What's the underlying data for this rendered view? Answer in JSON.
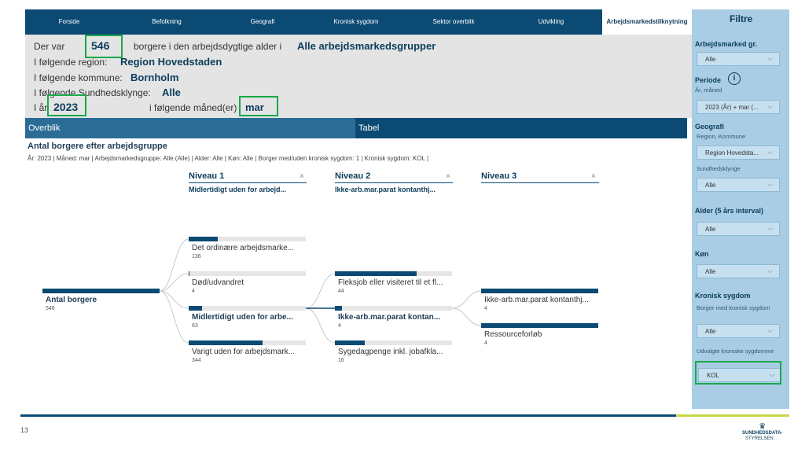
{
  "nav": {
    "tabs": [
      "Forside",
      "Befolkning",
      "Geografi",
      "Kronisk sygdom",
      "Sektor overblik",
      "Udvikling",
      "Arbejdsmarkedstilknytning"
    ]
  },
  "info": {
    "line1_prefix": "Der var",
    "count": "546",
    "line1_mid": "borgere i den arbejdsdygtige alder i",
    "group": "Alle arbejdsmarkedsgrupper",
    "region_label": "I følgende region:",
    "region": "Region Hovedstaden",
    "kommune_label": "I følgende kommune:",
    "kommune": "Bornholm",
    "klynge_label": "I følgende Sundhedsklynge:",
    "klynge": "Alle",
    "year_label": "I år",
    "year": "2023",
    "month_label": "i følgende måned(er)",
    "month": "mar"
  },
  "tabs2": {
    "overblik": "Overblik",
    "tabel": "Tabel"
  },
  "chart": {
    "title": "Antal borgere efter arbejdsgruppe",
    "filters": "År: 2023 | Måned: mar | Arbejdsmarkedsgruppe: Alle (Alle) | Alder: Alle | Køn: Alle | Borger med/uden kronisk sygdom: 1 | Kronisk sygdom: KOL |",
    "levels": [
      {
        "head": "Niveau 1",
        "sub": "Midlertidigt uden for arbejd..."
      },
      {
        "head": "Niveau 2",
        "sub": "Ikke-arb.mar.parat kontanthj..."
      },
      {
        "head": "Niveau 3",
        "sub": ""
      }
    ],
    "close_glyph": "×"
  },
  "chart_data": {
    "type": "decomposition-tree",
    "root": {
      "label": "Antal borgere",
      "value": 546
    },
    "level1": [
      {
        "label": "Det ordinære arbejdsmarke...",
        "value": 136
      },
      {
        "label": "Død/udvandret",
        "value": 4
      },
      {
        "label": "Midlertidigt uden for arbe...",
        "value": 63,
        "selected": true
      },
      {
        "label": "Varigt uden for arbejdsmark...",
        "value": 344
      }
    ],
    "level2": [
      {
        "label": "Fleksjob eller visiteret til et fl...",
        "value": 44
      },
      {
        "label": "Ikke-arb.mar.parat kontan...",
        "value": 4,
        "selected": true
      },
      {
        "label": "Sygedagpenge inkl. jobafkla...",
        "value": 16
      }
    ],
    "level3": [
      {
        "label": "Ikke-arb.mar.parat kontanthj...",
        "value": 4
      },
      {
        "label": "Ressourceforløb",
        "value": 4
      }
    ]
  },
  "pane": {
    "title": "Filtre",
    "arbejdsmarked_head": "Arbejdsmarked gr.",
    "arbejdsmarked_value": "Alle",
    "periode_head": "Periode",
    "periode_info": "i",
    "periode_sub": "År, måned",
    "periode_value": "2023 (År) + mar (...",
    "geografi_head": "Geografi",
    "geografi_sub": "Region, Kommune",
    "geografi_value": "Region Hovedsta...",
    "klynge_sub": "Sundhedsklynge",
    "klynge_value": "Alle",
    "alder_head": "Alder (5 års interval)",
    "alder_value": "Alle",
    "koen_head": "Køn",
    "koen_value": "Alle",
    "kronisk_head": "Kronisk sygdom",
    "kronisk_sub1": "Borger med kronisk sygdom",
    "kronisk_value1": "Alle",
    "kronisk_sub2": "Udvalgte kroniske sygdomme",
    "kronisk_value2": "KOL",
    "chevron": "⌵"
  },
  "footer": {
    "page_number": "13",
    "logo_line1": "SUNDHEDSDATA-",
    "logo_line2": "STYRELSEN",
    "logo_glyph": "♛"
  },
  "colors": {
    "nav": "#0b4a73",
    "info_bg": "#e4e4e4",
    "pane_bg": "#a9cde4",
    "highlight": "#1aa84b",
    "bar": "#0b4a73"
  }
}
